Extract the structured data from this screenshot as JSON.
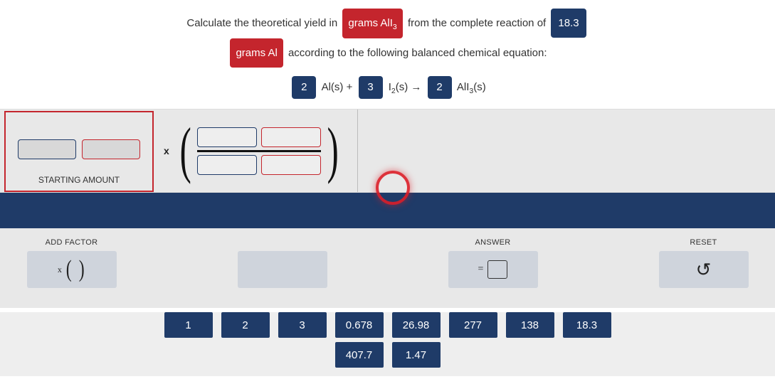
{
  "prompt": {
    "part1": "Calculate the theoretical yield in",
    "chip_red1": "grams AlI",
    "chip_red1_sub": "3",
    "part2": "from the complete reaction of",
    "chip_blue1": "18.3",
    "chip_red2": "grams Al",
    "part3": "according to the following balanced chemical equation:"
  },
  "equation": {
    "c1": "2",
    "s1a": "Al(s)",
    "plus1": "+",
    "c2": "3",
    "s2a": "I",
    "s2sub": "2",
    "s2b": "(s)",
    "arrow": "→",
    "c3": "2",
    "s3a": "AlI",
    "s3sub": "3",
    "s3b": "(s)"
  },
  "start_label": "STARTING AMOUNT",
  "controls": {
    "add_factor": "ADD FACTOR",
    "answer": "ANSWER",
    "reset": "RESET",
    "times": "x",
    "equals": "=",
    "reset_glyph": "↺"
  },
  "numbers_row1": [
    "1",
    "2",
    "3",
    "0.678",
    "26.98",
    "277",
    "138",
    "18.3"
  ],
  "numbers_row2": [
    "407.7",
    "1.47"
  ]
}
